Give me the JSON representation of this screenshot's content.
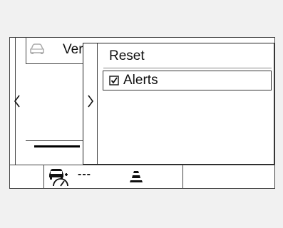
{
  "left_panel": {
    "title": "Ver",
    "icons": {
      "vehicle": "car-icon",
      "back": "chevron-left-icon"
    }
  },
  "menu": {
    "items": [
      {
        "label": "Reset",
        "selected": false,
        "checkbox": false
      },
      {
        "label": "Alerts",
        "selected": true,
        "checkbox": true,
        "checked": true
      }
    ],
    "icons": {
      "forward": "chevron-right-icon"
    }
  },
  "status_bar": {
    "speed_value": "---",
    "icons": {
      "speedometer": "speedometer-car-icon",
      "lane": "lane-icon"
    }
  }
}
